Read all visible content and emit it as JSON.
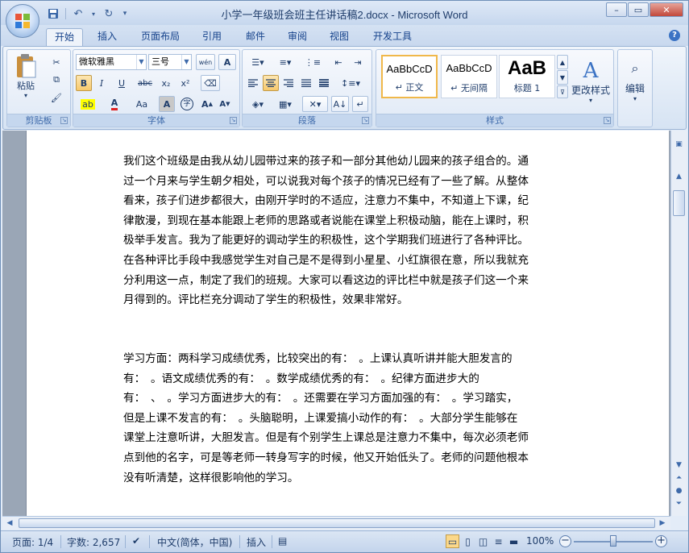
{
  "window": {
    "title": "小学一年级班会班主任讲话稿2.docx - Microsoft Word",
    "controls": {
      "minimize": "–",
      "restore": "▭",
      "close": "✕"
    }
  },
  "qat": {
    "save_icon": "save-icon",
    "undo_icon": "undo-icon",
    "redo_icon": "redo-icon"
  },
  "tabs": [
    "开始",
    "插入",
    "页面布局",
    "引用",
    "邮件",
    "审阅",
    "视图",
    "开发工具"
  ],
  "ribbon": {
    "clipboard": {
      "label": "剪贴板",
      "paste": "粘贴"
    },
    "font": {
      "label": "字体",
      "font_name": "微软雅黑",
      "font_size": "三号",
      "wen_label": "wén",
      "grow": "A",
      "shrink": "A",
      "bold": "B",
      "italic": "I",
      "underline": "U",
      "strike": "abc",
      "subscript": "x₂",
      "superscript": "x²",
      "case": "Aa",
      "char_shade": "A",
      "enclose": "字"
    },
    "paragraph": {
      "label": "段落"
    },
    "styles": {
      "label": "样式",
      "items": [
        {
          "sample": "AaBbCcD",
          "name": "↵ 正文"
        },
        {
          "sample": "AaBbCcD",
          "name": "↵ 无间隔"
        },
        {
          "sample": "AaB",
          "name": "标题 1"
        }
      ],
      "change": "更改样式"
    },
    "editing": {
      "label": "编辑"
    }
  },
  "document": {
    "paragraph1": [
      "我们这个班级是由我从幼儿园带过来的孩子和一部分其他幼儿园来的孩子组合的。通",
      "过一个月来与学生朝夕相处，可以说我对每个孩子的情况已经有了一些了解。从整体",
      "看来，孩子们进步都很大，由刚开学时的不适应，注意力不集中，不知道上下课，纪",
      "律散漫，到现在基本能跟上老师的思路或者说能在课堂上积极动脑，能在上课时，积",
      "极举手发言。我为了能更好的调动学生的积极性，这个学期我们班进行了各种评比。",
      "在各种评比手段中我感觉学生对自己是不是得到小星星、小红旗很在意，所以我就充",
      "分利用这一点，制定了我们的班规。大家可以看这边的评比栏中就是孩子们这一个来",
      "月得到的。评比栏充分调动了学生的积极性，效果非常好。"
    ],
    "paragraph2": [
      "学习方面：两科学习成绩优秀，比较突出的有：　。上课认真听讲并能大胆发言的",
      "有：　。语文成绩优秀的有：　。数学成绩优秀的有：　。纪律方面进步大的",
      "有：　、　。学习方面进步大的有：　。还需要在学习方面加强的有：　。学习踏实，",
      "但是上课不发言的有：　。头脑聪明，上课爱搞小动作的有：　。大部分学生能够在",
      "课堂上注意听讲，大胆发言。但是有个别学生上课总是注意力不集中，每次必须老师",
      "点到他的名字，可是等老师一转身写字的时候，他又开始低头了。老师的问题他根本",
      "没有听清楚，这样很影响他的学习。"
    ]
  },
  "status": {
    "page": "页面: 1/4",
    "words": "字数: 2,657",
    "language": "中文(简体，中国)",
    "mode": "插入",
    "zoom": "100%"
  }
}
